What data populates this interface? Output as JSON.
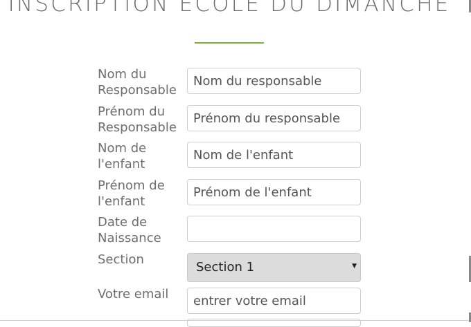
{
  "page": {
    "title": "INSCRIPTION ÉCOLE DU DIMANCHE"
  },
  "form": {
    "responsable_nom": {
      "label": "Nom du Responsable",
      "placeholder": "Nom du responsable",
      "value": ""
    },
    "responsable_prenom": {
      "label": "Prénom du Responsable",
      "placeholder": "Prénom du responsable",
      "value": ""
    },
    "enfant_nom": {
      "label": "Nom de l'enfant",
      "placeholder": "Nom de l'enfant",
      "value": ""
    },
    "enfant_prenom": {
      "label": "Prénom de l'enfant",
      "placeholder": "Prénom de l'enfant",
      "value": ""
    },
    "date_naissance": {
      "label": "Date de Naissance",
      "placeholder": "",
      "value": ""
    },
    "section": {
      "label": "Section",
      "selected": "Section 1"
    },
    "email": {
      "label": "Votre email",
      "placeholder": "entrer votre email",
      "value": ""
    }
  },
  "colors": {
    "accent": "#7ab32e",
    "select_bg": "#dcdcdc"
  },
  "icons": {
    "select_arrow": "dropdown-triangle-icon"
  }
}
